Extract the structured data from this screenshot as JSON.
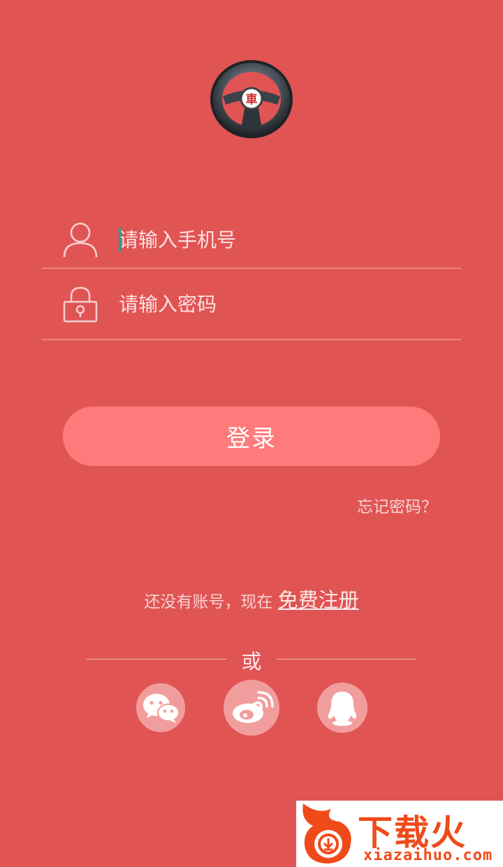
{
  "login": {
    "phone_placeholder": "请输入手机号",
    "password_placeholder": "请输入密码",
    "login_label": "登录",
    "forgot_label": "忘记密码？"
  },
  "register": {
    "prompt": "还没有账号，现在 ",
    "link": "免费注册"
  },
  "social": {
    "or_label": "或"
  },
  "logo": {
    "emblem": "車"
  },
  "watermark": {
    "main": "下载火",
    "sub": "xiazaihuo.com"
  },
  "colors": {
    "background": "#e15454",
    "button": "#ff7b7b",
    "social_circle": "#f29d9d",
    "caret": "#13a39a"
  }
}
